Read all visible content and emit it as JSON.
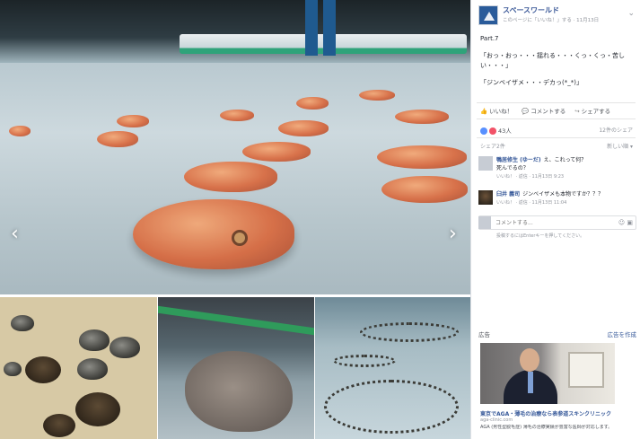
{
  "gallery": {
    "prev_arrow": "‹",
    "next_arrow": "›"
  },
  "post": {
    "page_name": "スペースワールド",
    "meta": "このページに「いいね！」する · 11月13日",
    "menu_icon": "⌄",
    "paragraphs": [
      "Part.7",
      "「おっ・おっ・・・揺れる・・・くっ・くっ・苦しい・・・」",
      "「ジンベイザメ・・・デカっ(*_*)」"
    ],
    "actions": {
      "like_icon": "👍",
      "like_label": "いいね！",
      "comment_icon": "💬",
      "comment_label": "コメントする",
      "share_icon": "↪",
      "share_label": "シェアする"
    },
    "reactions_count": "43人",
    "shares_label": "シェア2件",
    "order_label": "新しい順 ▾",
    "extra_label": "12件のシェア",
    "comments": [
      {
        "name": "鴨居修生 (ゆーだ)",
        "text": "え、これって何？",
        "second_line": "死んでるの？",
        "meta": "いいね！ · 返信 · 11月13日 9:23"
      },
      {
        "name": "臼井 義司",
        "text": "ジンベイザメも本物ですか？？？",
        "meta": "いいね！ · 返信 · 11月13日 11:04"
      }
    ],
    "comment_placeholder": "コメントする...",
    "comment_icons": "☺ ▣",
    "enter_hint": "投稿するにはEnterキーを押してください。"
  },
  "ad": {
    "label": "広告",
    "create_label": "広告を作成",
    "title": "東京でAGA・薄毛の治療なら表参道スキンクリニック",
    "site": "aga-clinic.com",
    "description": "AGA (男性型脱毛症) 薄毛の治療実績が豊富な医師が対応します。"
  }
}
